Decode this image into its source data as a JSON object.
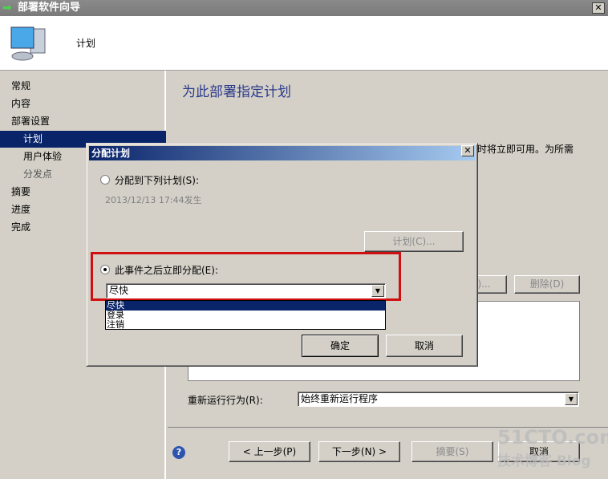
{
  "window": {
    "title": "部署软件向导",
    "close": "✕"
  },
  "header": {
    "title": "计划"
  },
  "nav": {
    "items": [
      {
        "label": "常规"
      },
      {
        "label": "内容"
      },
      {
        "label": "部署设置"
      },
      {
        "label": "计划"
      },
      {
        "label": "用户体验"
      },
      {
        "label": "分发点"
      },
      {
        "label": "摘要"
      },
      {
        "label": "进度"
      },
      {
        "label": "完成"
      }
    ]
  },
  "main": {
    "title": "为此部署指定计划",
    "partial_text": "时将立即可用。为所需",
    "partial_button": ")...",
    "delete_button": "删除(D)",
    "rerun_label": "重新运行行为(R):",
    "rerun_value": "始终重新运行程序"
  },
  "footer": {
    "help": "?",
    "prev": "< 上一步(P)",
    "next": "下一步(N) >",
    "summary": "摘要(S)",
    "cancel": "取消"
  },
  "watermark": {
    "line1": "51CTO.com",
    "line2": "技术博客  Blog"
  },
  "dialog": {
    "title": "分配计划",
    "close": "✕",
    "option1": {
      "label": "分配到下列计划(S):",
      "selected": false,
      "detail": "2013/12/13 17:44发生"
    },
    "schedule_button": "计划(C)...",
    "option2": {
      "label": "此事件之后立即分配(E):",
      "selected": true
    },
    "combo_value": "尽快",
    "options": [
      "尽快",
      "登录",
      "注销"
    ],
    "ok": "确定",
    "cancel": "取消"
  }
}
